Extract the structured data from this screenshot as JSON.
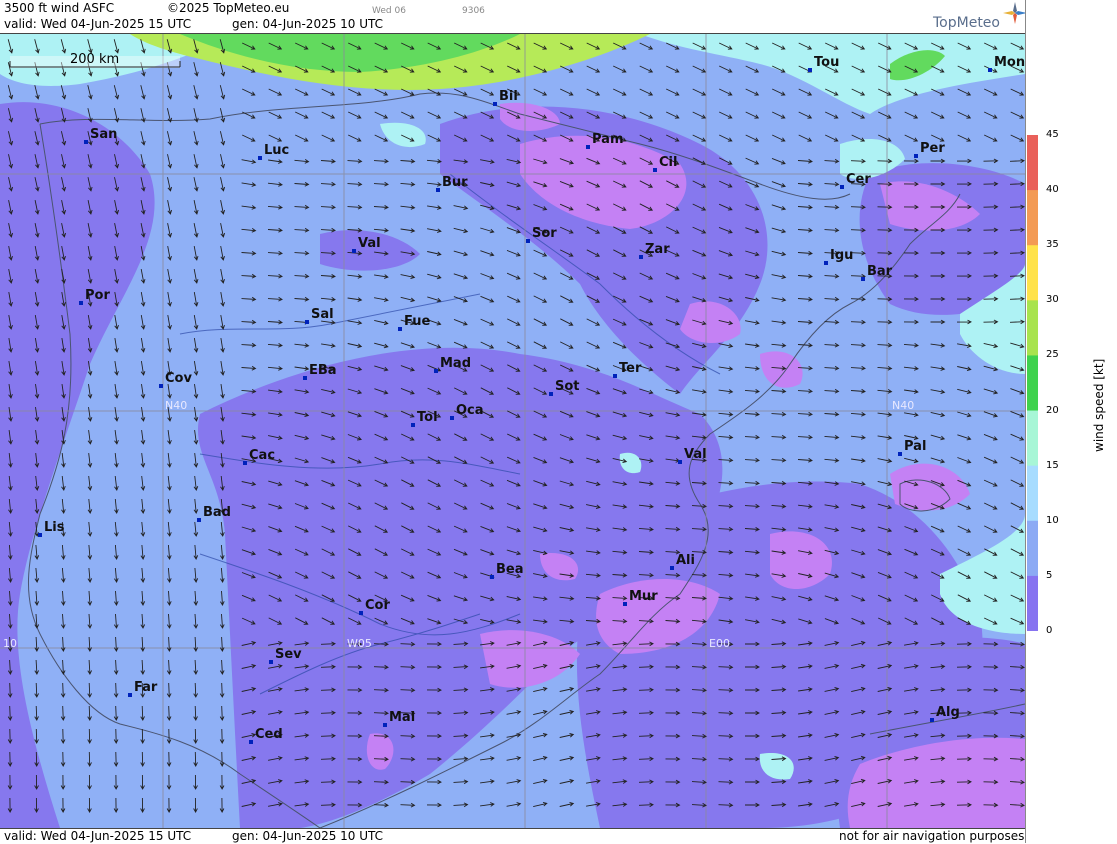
{
  "header": {
    "product": "3500 ft wind ASFC",
    "copyright": "©2025 TopMeteo.eu",
    "valid": "valid:  Wed  04-Jun-2025  15 UTC",
    "gen": "gen: 04-Jun-2025 10 UTC",
    "tab_label": "Wed 06",
    "tab_code": "9306",
    "brand": "TopMeteo"
  },
  "footer": {
    "valid": "valid:  Wed  04-Jun-2025  15 UTC",
    "gen": "gen: 04-Jun-2025 10 UTC",
    "disclaimer": "not for air navigation purposes"
  },
  "scale_bar": {
    "label": "200 km"
  },
  "grid_labels": [
    "N40",
    "N40",
    "W05",
    "E00",
    "10"
  ],
  "legend": {
    "title": "wind speed  [kt]",
    "ticks": [
      "45",
      "40",
      "35",
      "30",
      "25",
      "20",
      "15",
      "10",
      "5",
      "0"
    ],
    "colors": [
      "#e9605a",
      "#f39a54",
      "#ffe24a",
      "#a8e34e",
      "#3fd24d",
      "#a7f6d6",
      "#a7dcff",
      "#8caaf4",
      "#8773f0",
      "#c07ff4"
    ]
  },
  "cities": [
    {
      "name": "Tou"
    },
    {
      "name": "Mon"
    },
    {
      "name": "Bil"
    },
    {
      "name": "San"
    },
    {
      "name": "Luc"
    },
    {
      "name": "Pam"
    },
    {
      "name": "Cil"
    },
    {
      "name": "Per"
    },
    {
      "name": "Bur"
    },
    {
      "name": "Cer"
    },
    {
      "name": "Sor"
    },
    {
      "name": "Val"
    },
    {
      "name": "Zar"
    },
    {
      "name": "Igu"
    },
    {
      "name": "Bar"
    },
    {
      "name": "Por"
    },
    {
      "name": "Sal"
    },
    {
      "name": "Fue"
    },
    {
      "name": "Mad"
    },
    {
      "name": "EBa"
    },
    {
      "name": "Cov"
    },
    {
      "name": "Sot"
    },
    {
      "name": "Ter"
    },
    {
      "name": "Tol"
    },
    {
      "name": "Oca"
    },
    {
      "name": "Pal"
    },
    {
      "name": "Cac"
    },
    {
      "name": "Val"
    },
    {
      "name": "Bad"
    },
    {
      "name": "Lis"
    },
    {
      "name": "Ali"
    },
    {
      "name": "Bea"
    },
    {
      "name": "Mur"
    },
    {
      "name": "Cor"
    },
    {
      "name": "Sev"
    },
    {
      "name": "Far"
    },
    {
      "name": "Alg"
    },
    {
      "name": "Mal"
    },
    {
      "name": "Ced"
    }
  ],
  "colors": {
    "field_base": "#8fb0f6",
    "purple": "#8678ee",
    "violet": "#c481f4",
    "cyan": "#aef2f4",
    "green": "#62da5e",
    "lime": "#b6ea58"
  }
}
